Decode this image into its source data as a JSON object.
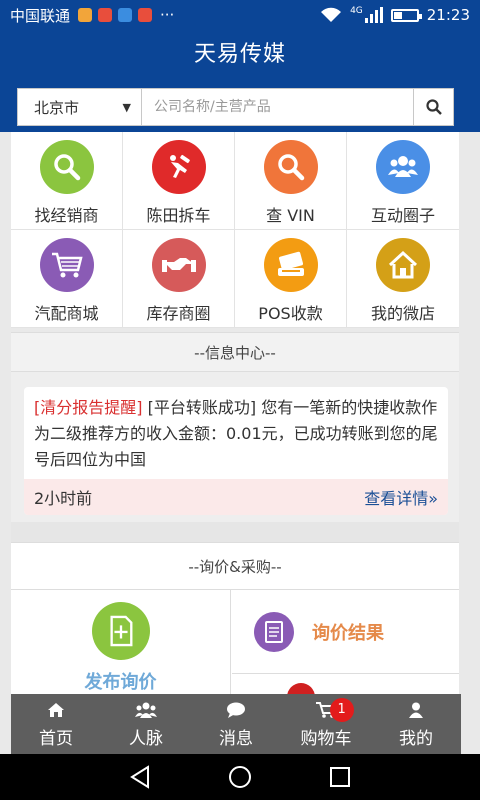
{
  "status_bar": {
    "carrier": "中国联通",
    "dots": "···",
    "network": "4G",
    "time": "21:23"
  },
  "header": {
    "title": "天易传媒"
  },
  "search": {
    "city": "北京市",
    "placeholder": "公司名称/主营产品"
  },
  "grid": [
    {
      "label": "找经销商",
      "icon": "magnifier-icon",
      "color": "#8bc53f"
    },
    {
      "label": "陈田拆车",
      "icon": "car-dismantle-icon",
      "color": "#e02a2a"
    },
    {
      "label": "查 VIN",
      "icon": "magnifier-icon",
      "color": "#f0753a"
    },
    {
      "label": "互动圈子",
      "icon": "people-icon",
      "color": "#4a8fe6"
    },
    {
      "label": "汽配商城",
      "icon": "cart-icon",
      "color": "#8a5bb5"
    },
    {
      "label": "库存商圈",
      "icon": "handshake-icon",
      "color": "#d65a5a"
    },
    {
      "label": "POS收款",
      "icon": "pos-card-icon",
      "color": "#f39c12"
    },
    {
      "label": "我的微店",
      "icon": "house-icon",
      "color": "#d4a017"
    }
  ],
  "info_center": {
    "title": "--信息中心--",
    "tag": "[清分报告提醒]",
    "tag2": "[平台转账成功]",
    "body": "您有一笔新的快捷收款作为二级推荐方的收入金额：0.01元，已成功转账到您的尾号后四位为中国",
    "time": "2小时前",
    "more": "查看详情»"
  },
  "inquiry": {
    "title": "--询价&采购--",
    "publish": "发布询价",
    "result": "询价结果"
  },
  "tabbar": [
    {
      "label": "首页",
      "icon": "home-icon"
    },
    {
      "label": "人脉",
      "icon": "contacts-icon"
    },
    {
      "label": "消息",
      "icon": "message-icon"
    },
    {
      "label": "购物车",
      "icon": "shopping-cart-icon",
      "badge": "1"
    },
    {
      "label": "我的",
      "icon": "user-icon"
    }
  ]
}
